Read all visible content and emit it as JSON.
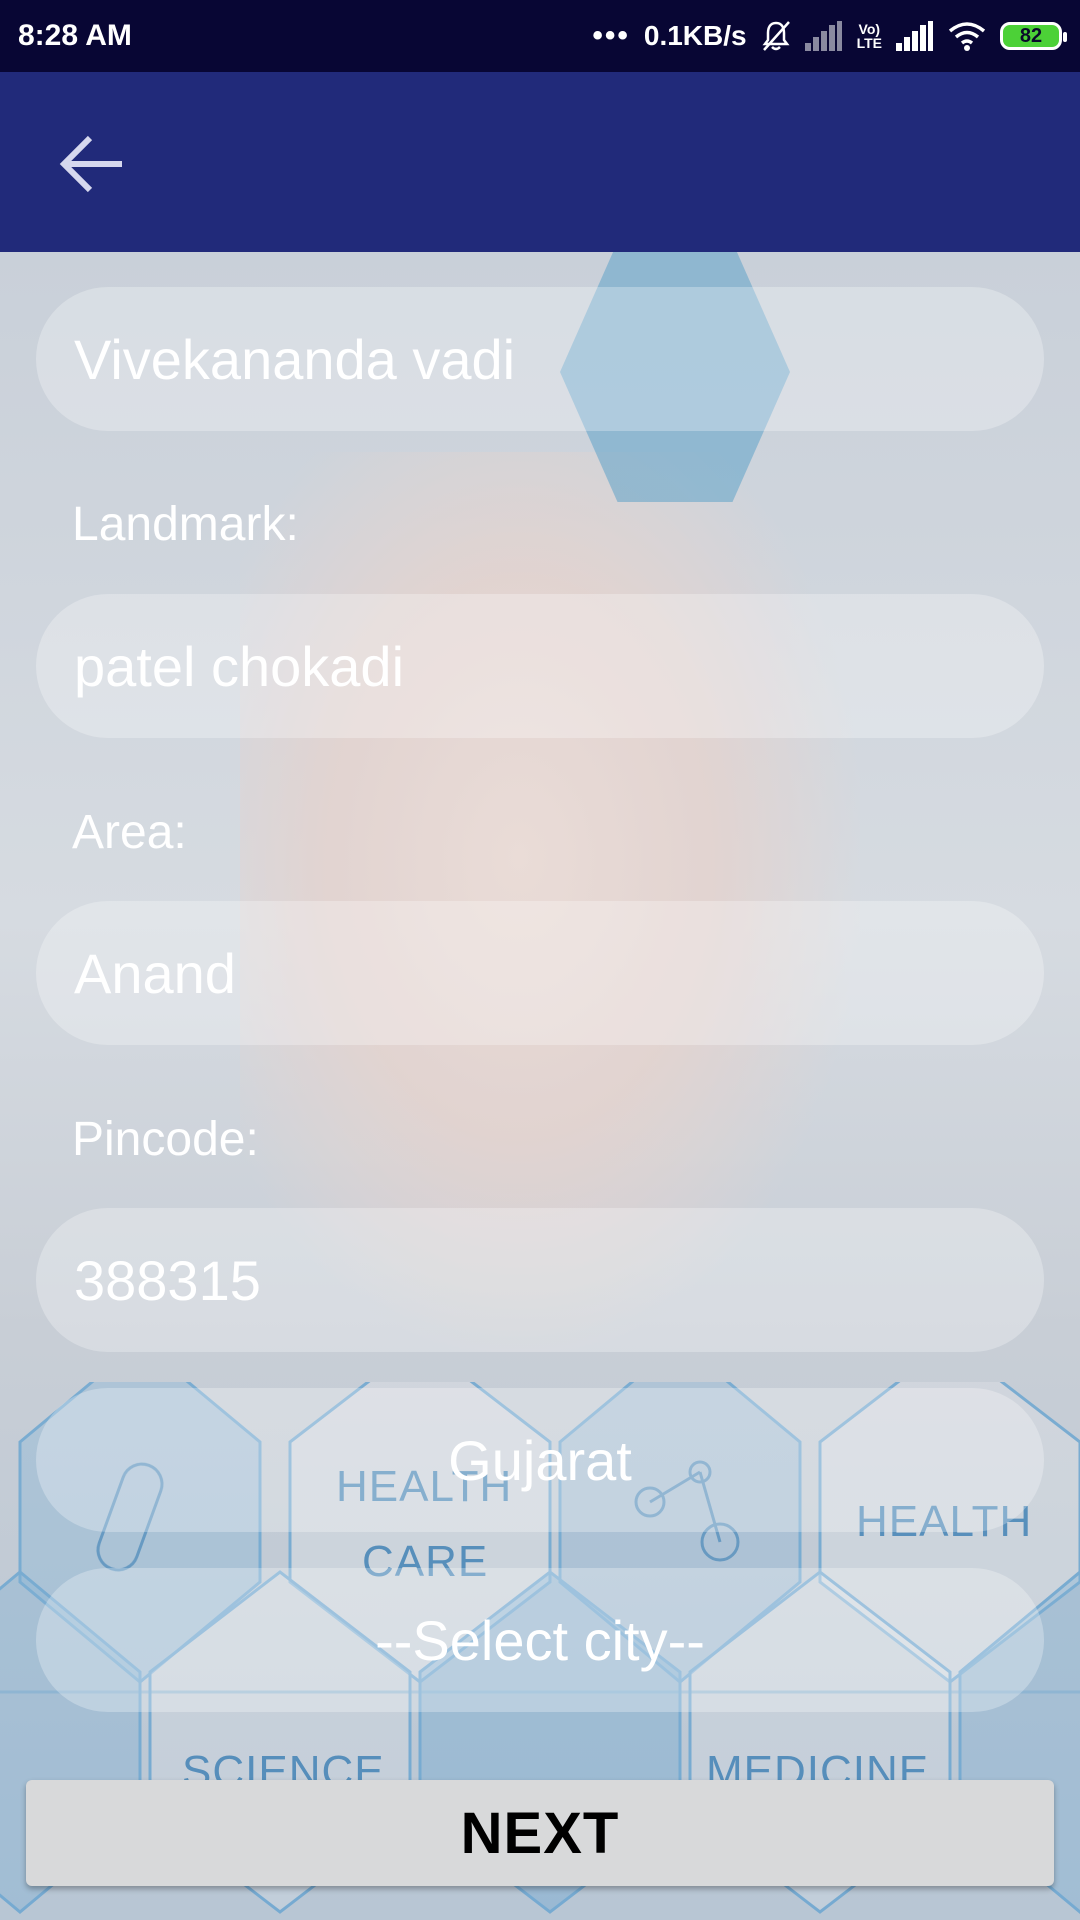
{
  "status_bar": {
    "time": "8:28 AM",
    "more": "•••",
    "net_speed": "0.1KB/s",
    "volte_top": "Vo)",
    "volte_bottom": "LTE",
    "battery": "82"
  },
  "app_bar": {
    "back_icon": "arrow-back-icon"
  },
  "background": {
    "words": [
      "HEALTH",
      "CARE",
      "HEALTH",
      "SCIENCE",
      "MEDICINE"
    ]
  },
  "form": {
    "address_value": "Vivekananda vadi",
    "landmark_label": "Landmark:",
    "landmark_value": "patel chokadi",
    "area_label": "Area:",
    "area_value": "Anand",
    "pincode_label": "Pincode:",
    "pincode_value": "388315",
    "state_selected": "Gujarat",
    "city_selected": "--Select city--"
  },
  "next_label": "NEXT",
  "colors": {
    "status_bar": "#080634",
    "app_bar": "#212a7a",
    "battery": "#4cd137"
  }
}
